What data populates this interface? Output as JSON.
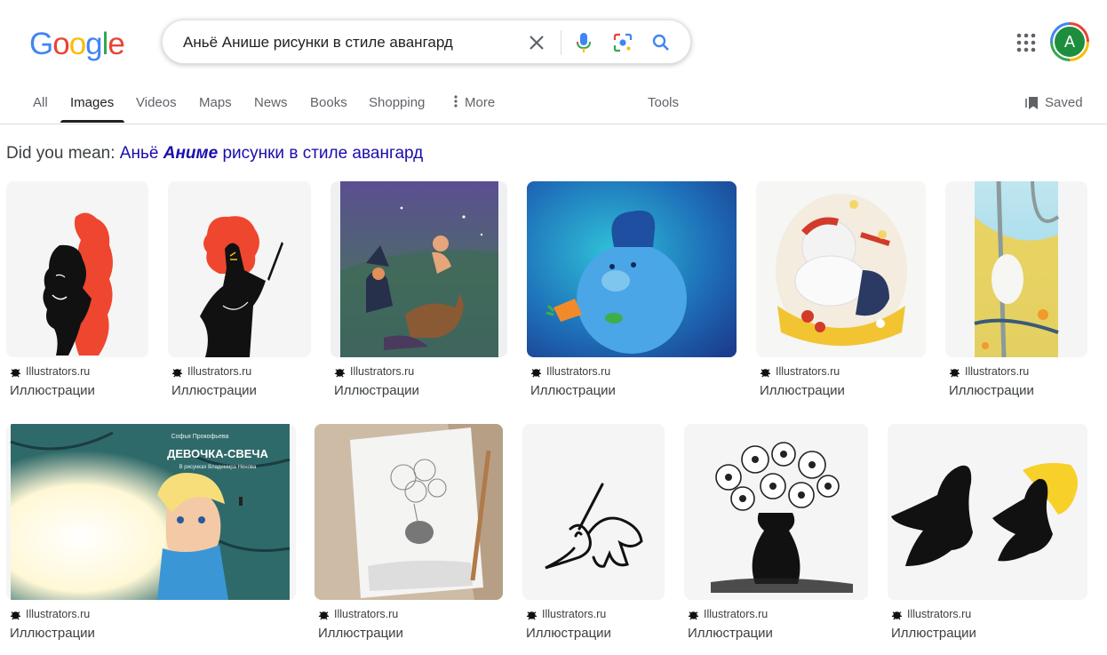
{
  "logo": [
    "G",
    "o",
    "o",
    "g",
    "l",
    "e"
  ],
  "logo_colors": [
    "#4285f4",
    "#ea4335",
    "#fbbc05",
    "#4285f4",
    "#34a853",
    "#ea4335"
  ],
  "search": {
    "query": "Аньё Анише рисунки в стиле авангард"
  },
  "avatar_letter": "A",
  "tabs": [
    {
      "label": "All"
    },
    {
      "label": "Images"
    },
    {
      "label": "Videos"
    },
    {
      "label": "Maps"
    },
    {
      "label": "News"
    },
    {
      "label": "Books"
    },
    {
      "label": "Shopping"
    },
    {
      "label": "More"
    },
    {
      "label": "Tools"
    }
  ],
  "saved_label": "Saved",
  "did_you_mean": {
    "prefix": "Did you mean:",
    "word1": "Аньё",
    "corrected": "Аниме",
    "rest": "рисунки в стиле авангард"
  },
  "results": [
    {
      "source": "Illustrators.ru",
      "title": "Иллюстрации"
    },
    {
      "source": "Illustrators.ru",
      "title": "Иллюстрации"
    },
    {
      "source": "Illustrators.ru",
      "title": "Иллюстрации"
    },
    {
      "source": "Illustrators.ru",
      "title": "Иллюстрации"
    },
    {
      "source": "Illustrators.ru",
      "title": "Иллюстрации"
    },
    {
      "source": "Illustrators.ru",
      "title": "Иллюстрации"
    },
    {
      "source": "Illustrators.ru",
      "title": "Иллюстрации"
    },
    {
      "source": "Illustrators.ru",
      "title": "Иллюстрации"
    },
    {
      "source": "Illustrators.ru",
      "title": "Иллюстрации"
    },
    {
      "source": "Illustrators.ru",
      "title": "Иллюстрации"
    },
    {
      "source": "Illustrators.ru",
      "title": "Иллюстрации"
    }
  ],
  "book_cover": {
    "author": "Софья Прокофьева",
    "title": "ДЕВОЧКА-СВЕЧА",
    "illustrator": "В рисунках Владимира Ненова"
  }
}
